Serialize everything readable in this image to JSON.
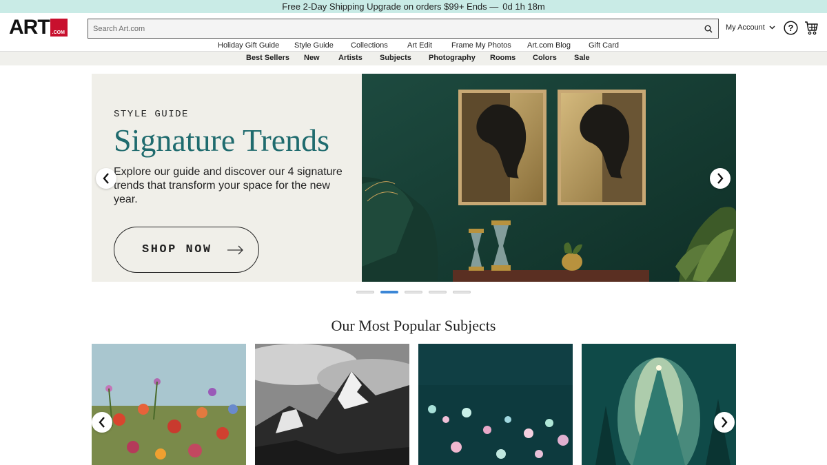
{
  "promo": {
    "text": "Free 2-Day Shipping Upgrade on orders $99+ Ends —",
    "timer": "0d 1h 18m"
  },
  "header": {
    "logo_text": "ART",
    "logo_sub": ".COM",
    "search_placeholder": "Search Art.com",
    "account_label": "My Account"
  },
  "nav": {
    "row1": [
      "Holiday Gift Guide",
      "Style Guide",
      "Collections",
      "Art Edit",
      "Frame My Photos",
      "Art.com Blog",
      "Gift Card"
    ],
    "row2": [
      "Best Sellers",
      "New",
      "Artists",
      "Subjects",
      "Photography",
      "Rooms",
      "Colors",
      "Sale"
    ]
  },
  "hero": {
    "eyebrow": "STYLE GUIDE",
    "title": "Signature Trends",
    "text": "Explore our guide and discover our 4 signature trends that transform your space for the new year.",
    "cta": "SHOP NOW",
    "slide_count": 5,
    "active_slide": 2
  },
  "popular": {
    "title": "Our Most Popular Subjects",
    "tiles": [
      "floral-painting",
      "mountain-photo",
      "abstract-teal",
      "christmas-tree"
    ]
  },
  "colors": {
    "accent_teal": "#1f6b6e",
    "promo_bg": "#c9ebe6",
    "dot_active": "#3b86d6",
    "logo_red": "#c8102e"
  }
}
